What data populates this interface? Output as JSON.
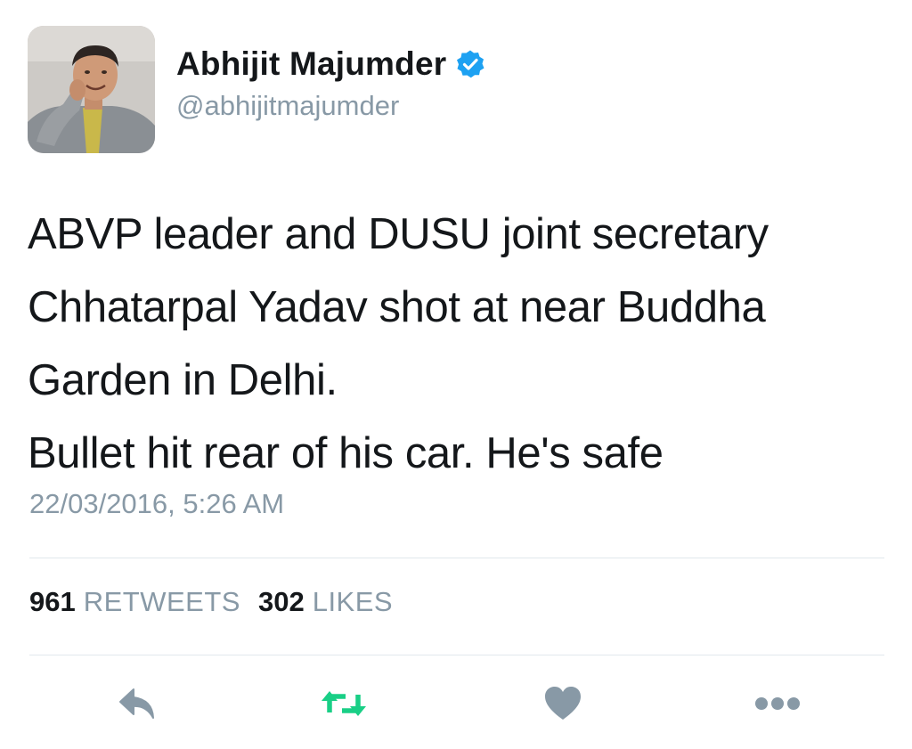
{
  "user": {
    "display_name": "Abhijit Majumder",
    "handle": "@abhijitmajumder",
    "verified": true
  },
  "tweet": {
    "lines": [
      "ABVP leader and DUSU joint secretary",
      "Chhatarpal Yadav shot at near Buddha",
      "Garden in Delhi.",
      "Bullet hit rear of his car. He's safe"
    ],
    "timestamp": "22/03/2016, 5:26 AM"
  },
  "stats": {
    "retweets_count": "961",
    "retweets_label": "RETWEETS",
    "likes_count": "302",
    "likes_label": "LIKES"
  },
  "actions": [
    {
      "icon": "reply-icon"
    },
    {
      "icon": "retweet-icon"
    },
    {
      "icon": "heart-icon"
    },
    {
      "icon": "more-icon"
    }
  ],
  "colors": {
    "verified_blue": "#1da1f2",
    "retweet_green": "#19cf86",
    "icon_gray": "#8899a6",
    "muted_text": "#8899a6"
  }
}
